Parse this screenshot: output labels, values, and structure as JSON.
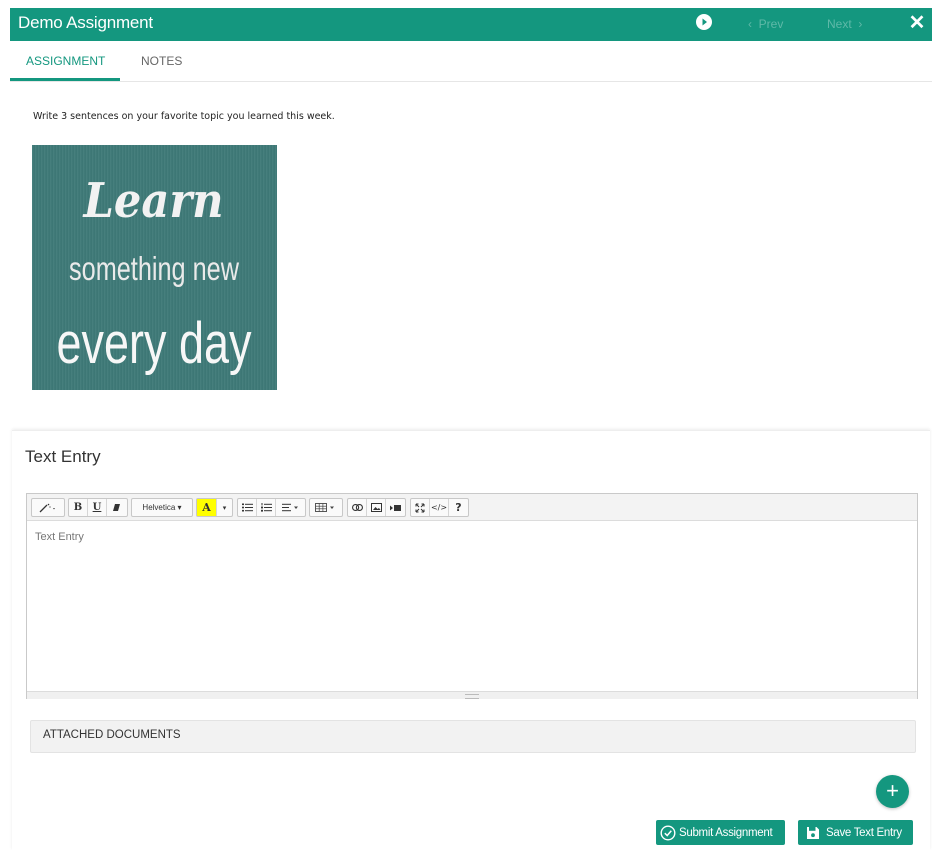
{
  "header": {
    "title": "Demo Assignment",
    "prev_label": "Prev",
    "next_label": "Next",
    "prev_chevron": "‹",
    "next_chevron": "›",
    "close_label": "✕",
    "accent_color": "#14977f"
  },
  "tabs": [
    {
      "label": "ASSIGNMENT",
      "active": true
    },
    {
      "label": "NOTES",
      "active": false
    }
  ],
  "assignment": {
    "instructions": "Write 3 sentences on your favorite topic you learned this week.",
    "image_text": {
      "line1": "Learn",
      "line2": "something new",
      "line3": "every day"
    }
  },
  "text_entry": {
    "title": "Text Entry",
    "placeholder": "Text Entry",
    "toolbar": {
      "font_name": "Helvetica ▾",
      "bold": "B",
      "underline": "U",
      "highlight": "A",
      "help": "?",
      "code": "</>"
    }
  },
  "attachments": {
    "label": "ATTACHED DOCUMENTS"
  },
  "actions": {
    "add_label": "+",
    "submit_label": "Submit Assignment",
    "save_label": "Save Text Entry"
  },
  "icons": [
    "play-icon",
    "close-icon",
    "magic-wand-icon",
    "eraser-icon",
    "unordered-list-icon",
    "ordered-list-icon",
    "align-icon",
    "table-icon",
    "link-icon",
    "image-icon",
    "video-icon",
    "fullscreen-icon",
    "code-icon",
    "help-icon",
    "check-circle-icon",
    "floppy-disk-icon",
    "plus-icon"
  ]
}
